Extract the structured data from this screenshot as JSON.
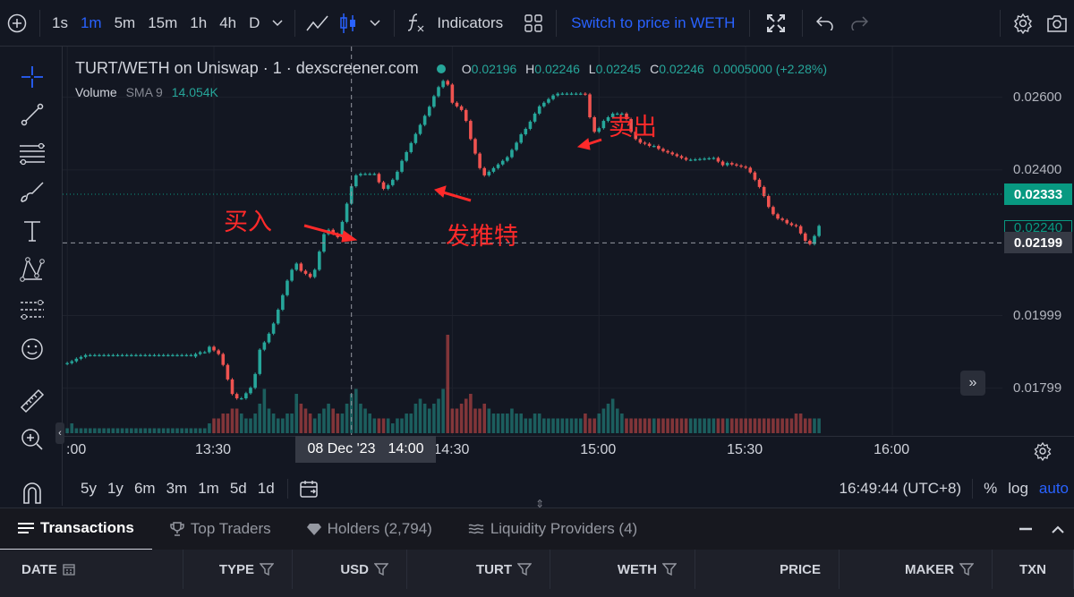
{
  "toolbar": {
    "intervals": [
      "1s",
      "1m",
      "5m",
      "15m",
      "1h",
      "4h",
      "D"
    ],
    "active_interval": "1m",
    "indicators_label": "Indicators",
    "switch_label": "Switch to price in WETH"
  },
  "legend": {
    "title": "TURT/WETH on Uniswap · 1 · dexscreener.com",
    "o_label": "O",
    "o": "0.02196",
    "h_label": "H",
    "h": "0.02246",
    "l_label": "L",
    "l": "0.02245",
    "c_label": "C",
    "c": "0.02246",
    "change": "0.0005000 (+2.28%)",
    "volume_label": "Volume",
    "sma_label": "SMA 9",
    "volume_value": "14.054K"
  },
  "annotations": {
    "buy": "买入",
    "tweet": "发推特",
    "sell": "卖出"
  },
  "bottom": {
    "ranges": [
      "5y",
      "1y",
      "6m",
      "3m",
      "1m",
      "5d",
      "1d"
    ],
    "time": "16:49:44 (UTC+8)",
    "percent": "%",
    "log": "log",
    "auto": "auto"
  },
  "tabs": [
    {
      "label": "Transactions",
      "icon": "list-icon"
    },
    {
      "label": "Top Traders",
      "icon": "trophy-icon"
    },
    {
      "label": "Holders (2,794)",
      "icon": "diamond-icon"
    },
    {
      "label": "Liquidity Providers (4)",
      "icon": "waves-icon"
    }
  ],
  "table_headers": [
    "DATE",
    "TYPE",
    "USD",
    "TURT",
    "WETH",
    "PRICE",
    "MAKER",
    "TXN"
  ],
  "colors": {
    "up": "#26a69a",
    "down": "#ef5350",
    "accent": "#2962ff",
    "annotation": "#ff2a2a"
  },
  "chart_data": {
    "type": "candlestick",
    "x_ticks": [
      ":00",
      "13:30",
      "14:30",
      "15:00",
      "15:30",
      "16:00"
    ],
    "x_tick_values": [
      0,
      32,
      84,
      116,
      148,
      180
    ],
    "crosshair_x_label": {
      "date": "08 Dec '23",
      "time": "14:00"
    },
    "crosshair_x_value": 62,
    "crosshair_y_value": 0.02199,
    "y_ticks": [
      "0.02600",
      "0.02400",
      "0.01999",
      "0.01799"
    ],
    "y_tick_values": [
      0.026,
      0.024,
      0.01999,
      0.01799
    ],
    "ylim": [
      0.0167,
      0.0272
    ],
    "xlim": [
      -1,
      204
    ],
    "current_price_label": "0.02333",
    "current_price": 0.02333,
    "hidden_price_label": "0.02240",
    "hidden_price": 0.0224,
    "crosshair_price_label": "0.02199",
    "candle_open": [
      0.01866,
      0.01868,
      0.01873,
      0.0188,
      0.01885,
      0.0189,
      0.0189,
      0.0189,
      0.0189,
      0.0189,
      0.0189,
      0.0189,
      0.0189,
      0.0189,
      0.0189,
      0.0189,
      0.0189,
      0.0189,
      0.0189,
      0.0189,
      0.0189,
      0.0189,
      0.0189,
      0.0189,
      0.0189,
      0.0189,
      0.0189,
      0.0189,
      0.01886,
      0.01893,
      0.01898,
      0.01898,
      0.01913,
      0.01903,
      0.01893,
      0.01863,
      0.01823,
      0.01783,
      0.01771,
      0.01771,
      0.01785,
      0.018,
      0.01838,
      0.01905,
      0.01925,
      0.01949,
      0.01977,
      0.02015,
      0.02055,
      0.02095,
      0.02125,
      0.02142,
      0.02122,
      0.02114,
      0.02105,
      0.02125,
      0.02175,
      0.02223,
      0.02235,
      0.02224,
      0.02215,
      0.02257,
      0.02307,
      0.02355,
      0.02385,
      0.02389,
      0.02389,
      0.02389,
      0.02389,
      0.02366,
      0.02348,
      0.02358,
      0.02373,
      0.02395,
      0.02425,
      0.02449,
      0.02474,
      0.02499,
      0.02524,
      0.02549,
      0.02574,
      0.02603,
      0.02628,
      0.02645,
      0.02635,
      0.02585,
      0.02575,
      0.02565,
      0.02535,
      0.02485,
      0.02445,
      0.02405,
      0.02385,
      0.02395,
      0.02405,
      0.02415,
      0.02425,
      0.02435,
      0.02455,
      0.02475,
      0.02498,
      0.02513,
      0.02533,
      0.02555,
      0.02575,
      0.02585,
      0.02595,
      0.02605,
      0.0261,
      0.0261,
      0.0261,
      0.0261,
      0.0261,
      0.0261,
      0.02608,
      0.02545,
      0.02505,
      0.02515,
      0.02535,
      0.02545,
      0.02555,
      0.02555,
      0.02555,
      0.0254,
      0.02505,
      0.02485,
      0.02475,
      0.02472,
      0.02466,
      0.02466,
      0.02458,
      0.02452,
      0.02448,
      0.02443,
      0.02438,
      0.02433,
      0.02428,
      0.02428,
      0.02429,
      0.0243,
      0.02431,
      0.02432,
      0.02433,
      0.02423,
      0.02413,
      0.02419,
      0.02415,
      0.02412,
      0.02409,
      0.02406,
      0.02393,
      0.02373,
      0.02353,
      0.02328,
      0.02298,
      0.02278,
      0.02266,
      0.02262,
      0.02253,
      0.02248,
      0.02245,
      0.02225,
      0.02205,
      0.02196,
      0.02218
    ],
    "candle_close": [
      0.01868,
      0.01873,
      0.0188,
      0.01885,
      0.0189,
      0.0189,
      0.0189,
      0.0189,
      0.0189,
      0.0189,
      0.0189,
      0.0189,
      0.0189,
      0.0189,
      0.0189,
      0.0189,
      0.0189,
      0.0189,
      0.0189,
      0.0189,
      0.0189,
      0.0189,
      0.0189,
      0.0189,
      0.0189,
      0.0189,
      0.0189,
      0.0189,
      0.01893,
      0.01898,
      0.01898,
      0.01913,
      0.01903,
      0.01893,
      0.01863,
      0.01823,
      0.01783,
      0.01771,
      0.01771,
      0.01785,
      0.018,
      0.01838,
      0.01905,
      0.01925,
      0.01949,
      0.01977,
      0.02015,
      0.02055,
      0.02095,
      0.02125,
      0.02142,
      0.02122,
      0.02114,
      0.02105,
      0.02125,
      0.02175,
      0.02223,
      0.02235,
      0.02224,
      0.02215,
      0.02257,
      0.02307,
      0.02355,
      0.02385,
      0.02389,
      0.02389,
      0.02389,
      0.02389,
      0.02366,
      0.02348,
      0.02358,
      0.02373,
      0.02395,
      0.02425,
      0.02449,
      0.02474,
      0.02499,
      0.02524,
      0.02549,
      0.02574,
      0.02603,
      0.02628,
      0.02645,
      0.02635,
      0.02585,
      0.02575,
      0.02565,
      0.02535,
      0.02485,
      0.02445,
      0.02405,
      0.02385,
      0.02395,
      0.02405,
      0.02415,
      0.02425,
      0.02435,
      0.02455,
      0.02475,
      0.02498,
      0.02513,
      0.02533,
      0.02555,
      0.02575,
      0.02585,
      0.02595,
      0.02605,
      0.0261,
      0.0261,
      0.0261,
      0.0261,
      0.0261,
      0.0261,
      0.02608,
      0.02545,
      0.02505,
      0.02515,
      0.02535,
      0.02545,
      0.02555,
      0.02555,
      0.02555,
      0.0254,
      0.02505,
      0.02485,
      0.02475,
      0.02472,
      0.02466,
      0.02466,
      0.02458,
      0.02452,
      0.02448,
      0.02443,
      0.02438,
      0.02433,
      0.02428,
      0.02428,
      0.02429,
      0.0243,
      0.02431,
      0.02432,
      0.02433,
      0.02423,
      0.02413,
      0.02419,
      0.02415,
      0.02412,
      0.02409,
      0.02406,
      0.02393,
      0.02373,
      0.02353,
      0.02328,
      0.02298,
      0.02278,
      0.02266,
      0.02262,
      0.02253,
      0.02248,
      0.02245,
      0.02225,
      0.02205,
      0.02196,
      0.02218,
      0.02246
    ],
    "volume_note": "relative volume per candle",
    "volume": [
      1,
      2,
      1,
      1,
      1,
      1,
      1,
      1,
      1,
      1,
      1,
      1,
      1,
      1,
      1,
      1,
      1,
      1,
      1,
      1,
      1,
      1,
      1,
      1,
      1,
      1,
      1,
      1,
      1,
      1,
      1,
      2,
      3,
      3,
      4,
      4,
      5,
      5,
      4,
      3,
      3,
      4,
      6,
      9,
      5,
      4,
      3,
      3,
      4,
      4,
      8,
      6,
      5,
      4,
      3,
      4,
      5,
      6,
      5,
      4,
      4,
      6,
      8,
      9,
      6,
      5,
      4,
      3,
      3,
      3,
      3,
      2,
      3,
      3,
      4,
      4,
      6,
      7,
      6,
      5,
      6,
      7,
      9,
      20,
      5,
      5,
      6,
      7,
      8,
      5,
      5,
      6,
      5,
      4,
      4,
      4,
      4,
      5,
      4,
      4,
      3,
      3,
      4,
      4,
      3,
      3,
      3,
      3,
      3,
      3,
      3,
      3,
      3,
      4,
      3,
      3,
      4,
      5,
      6,
      7,
      5,
      4,
      3,
      3,
      3,
      3,
      3,
      3,
      3,
      3,
      3,
      3,
      3,
      3,
      3,
      3,
      3,
      3,
      3,
      3,
      3,
      3,
      3,
      3,
      3,
      3,
      3,
      3,
      3,
      3,
      3,
      3,
      3,
      3,
      3,
      3,
      3,
      3,
      3,
      4,
      4,
      3,
      3,
      3,
      3,
      3,
      3
    ]
  }
}
